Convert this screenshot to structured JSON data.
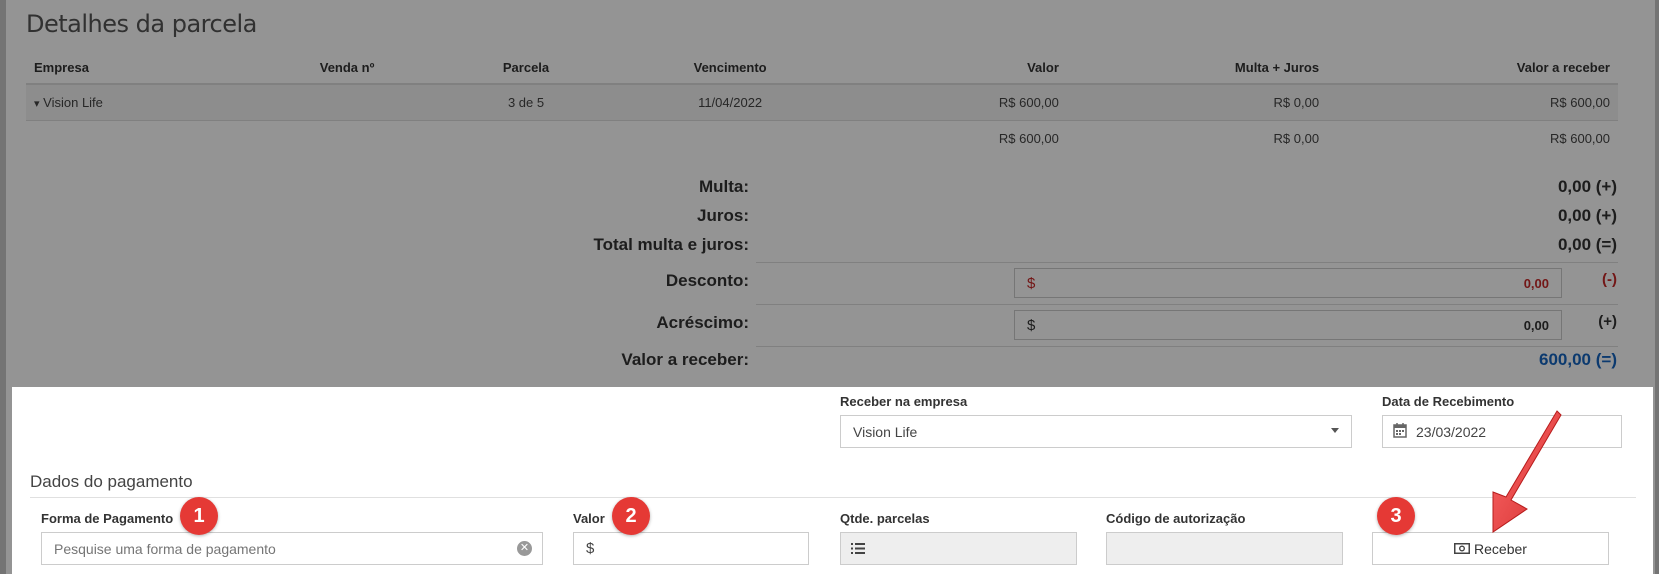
{
  "details": {
    "title": "Detalhes da parcela",
    "columns": [
      "Empresa",
      "Venda nº",
      "Parcela",
      "Vencimento",
      "Valor",
      "Multa + Juros",
      "Valor a receber"
    ],
    "row": {
      "caret": "▾",
      "empresa": "Vision Life",
      "venda": "",
      "parcela": "3 de 5",
      "vencimento": "11/04/2022",
      "valor": "R$ 600,00",
      "multa_juros": "R$ 0,00",
      "valor_receber": "R$ 600,00"
    },
    "totals": {
      "valor": "R$ 600,00",
      "multa_juros": "R$ 0,00",
      "valor_receber": "R$ 600,00"
    }
  },
  "summary": {
    "multa_label": "Multa:",
    "multa_value": "0,00 (+)",
    "juros_label": "Juros:",
    "juros_value": "0,00 (+)",
    "total_label": "Total multa e juros:",
    "total_value": "0,00 (=)",
    "desconto_label": "Desconto:",
    "desconto_currency": "$",
    "desconto_value": "0,00",
    "desconto_sign": "(-)",
    "acrescimo_label": "Acréscimo:",
    "acrescimo_currency": "$",
    "acrescimo_value": "0,00",
    "acrescimo_sign": "(+)",
    "receber_label": "Valor a receber:",
    "receber_value": "600,00 (=)"
  },
  "payment": {
    "empresa_label": "Receber na empresa",
    "empresa_value": "Vision Life",
    "data_label": "Data de Recebimento",
    "data_value": "23/03/2022",
    "section_title": "Dados do pagamento",
    "forma_label": "Forma de Pagamento",
    "forma_placeholder": "Pesquise uma forma de pagamento",
    "valor_label": "Valor",
    "valor_currency": "$",
    "parcelas_label": "Qtde. parcelas",
    "autorizacao_label": "Código de autorização",
    "receber_button": "Receber"
  },
  "badges": [
    "1",
    "2",
    "3"
  ],
  "colors": {
    "overlay": "#000000",
    "badge": "#e53935",
    "arrow": "#e53935",
    "desconto": "#c62828",
    "receber_total": "#1565c0"
  }
}
